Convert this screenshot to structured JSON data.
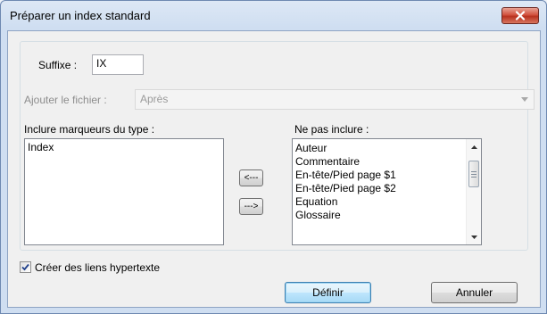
{
  "window": {
    "title": "Préparer un index standard",
    "close_icon": "close-icon"
  },
  "suffix": {
    "label": "Suffixe :",
    "value": "IX"
  },
  "append_file": {
    "label": "Ajouter le fichier :",
    "selected": "Après",
    "enabled": false
  },
  "include": {
    "label": "Inclure marqueurs du type :",
    "items": [
      "Index"
    ]
  },
  "exclude": {
    "label": "Ne pas inclure :",
    "items": [
      "Auteur",
      "Commentaire",
      "En-tête/Pied page $1",
      "En-tête/Pied page $2",
      "Equation",
      "Glossaire"
    ]
  },
  "move_buttons": {
    "left": "<---",
    "right": "--->"
  },
  "hyperlinks": {
    "label": "Créer des liens hypertexte",
    "checked": true
  },
  "actions": {
    "ok": "Définir",
    "cancel": "Annuler"
  },
  "colors": {
    "close_button": "#c9452f",
    "default_button_border": "#3c7fb1"
  }
}
